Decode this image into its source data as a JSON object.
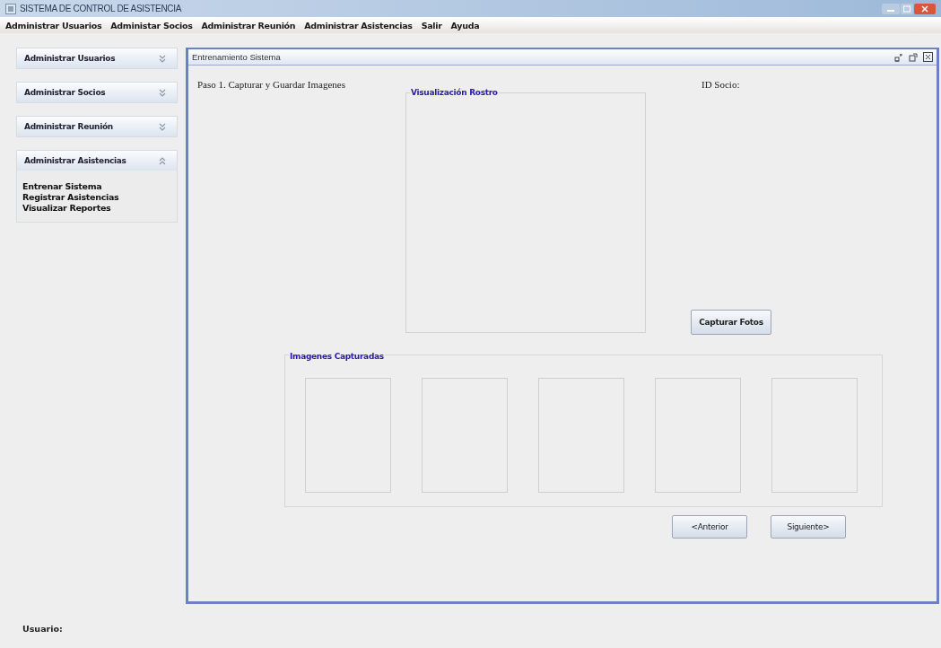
{
  "window": {
    "title": "SISTEMA DE CONTROL DE ASISTENCIA"
  },
  "menu": [
    "Administrar Usuarios",
    "Administar Socios",
    "Administrar Reunión",
    "Administrar Asistencias",
    "Salir",
    "Ayuda"
  ],
  "sidebar": {
    "panels": [
      {
        "title": "Administrar Usuarios",
        "expanded": false
      },
      {
        "title": "Administrar Socios",
        "expanded": false
      },
      {
        "title": "Administrar Reunión",
        "expanded": false
      },
      {
        "title": "Administrar Asistencias",
        "expanded": true,
        "items": [
          "Entrenar Sistema",
          "Registrar Asistencias",
          "Visualizar Reportes"
        ]
      }
    ]
  },
  "frame": {
    "title": "Entrenamiento Sistema",
    "step": "Paso 1. Capturar y Guardar Imagenes",
    "id_label": "ID Socio:",
    "face_group": "Visualización Rostro",
    "capture_button": "Capturar Fotos",
    "images_group": "Imagenes Capturadas",
    "image_slots": [
      {
        "filled": false
      },
      {
        "filled": false
      },
      {
        "filled": false
      },
      {
        "filled": false
      },
      {
        "filled": false
      }
    ],
    "buttons": [
      "<Anterior",
      "Siguiente>"
    ]
  },
  "status": {
    "user_label": "Usuario:"
  }
}
